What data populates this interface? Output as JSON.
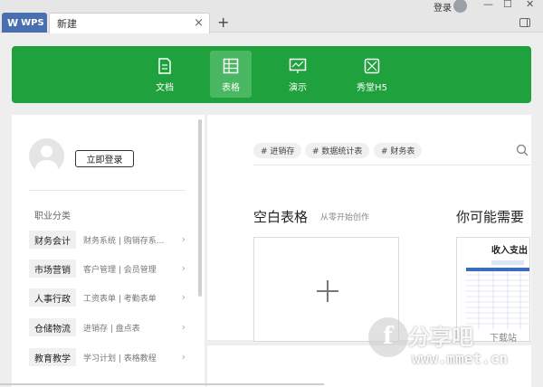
{
  "titlebar": {
    "app_tab": "WPS",
    "doc_tab": "新建",
    "close": "×",
    "add": "+",
    "login": "登录",
    "minimize": "—",
    "maximize": "☐",
    "close_window": "✕"
  },
  "nav": {
    "items": [
      {
        "label": "文档",
        "icon": "document-icon"
      },
      {
        "label": "表格",
        "icon": "table-icon",
        "active": true
      },
      {
        "label": "演示",
        "icon": "presentation-icon"
      },
      {
        "label": "秀堂H5",
        "icon": "h5-icon"
      }
    ]
  },
  "account": {
    "login_button": "立即登录"
  },
  "categories": {
    "title": "职业分类",
    "items": [
      {
        "label": "财务会计",
        "sub": "财务系统 | 购销存系..."
      },
      {
        "label": "市场营销",
        "sub": "客户管理 | 会员管理"
      },
      {
        "label": "人事行政",
        "sub": "工资表单 | 考勤表单"
      },
      {
        "label": "仓储物流",
        "sub": "进销存 | 盘点表"
      },
      {
        "label": "教育教学",
        "sub": "学习计划 | 表格教程"
      }
    ]
  },
  "search": {
    "tags": [
      "# 进销存",
      "# 数据统计表",
      "# 财务表"
    ]
  },
  "main": {
    "blank_title": "空白表格",
    "blank_subtitle": "从零开始创作",
    "maybe_title": "你可能需要",
    "template_title": "收入支出"
  },
  "watermark": {
    "main": "分享吧",
    "small": "下载站",
    "url": "www.mmet.cn",
    "f": "f"
  },
  "colors": {
    "brand_green": "#1fa13e",
    "wps_blue": "#4a6fb0"
  }
}
